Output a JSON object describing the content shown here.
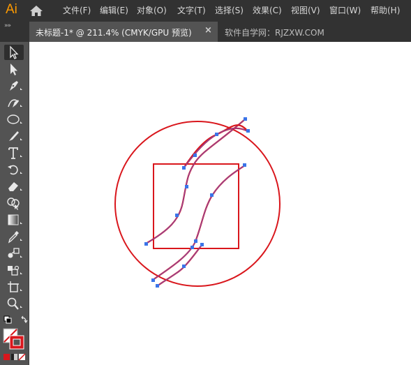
{
  "app": {
    "logo": "Ai"
  },
  "menu": {
    "items": [
      "文件(F)",
      "编辑(E)",
      "对象(O)",
      "文字(T)",
      "选择(S)",
      "效果(C)",
      "视图(V)",
      "窗口(W)",
      "帮助(H)"
    ]
  },
  "tabs": {
    "active": {
      "label": "未标题-1* @ 211.4% (CMYK/GPU 预览)",
      "close": "×"
    },
    "inactive": {
      "label": "软件自学网：RJZXW.COM"
    }
  },
  "toolbar": {
    "tools": [
      "selection-tool",
      "direct-selection-tool",
      "pen-tool",
      "curvature-tool",
      "ellipse-tool",
      "paintbrush-tool",
      "type-tool",
      "rotate-tool",
      "eraser-tool",
      "shape-builder-tool",
      "gradient-tool",
      "eyedropper-tool",
      "blend-tool",
      "live-paint-tool",
      "artboard-tool",
      "zoom-tool"
    ],
    "fill_color": "#ffffff",
    "stroke_color": "#d9161c"
  },
  "artwork": {
    "circle_stroke": "#d9161c",
    "square_stroke": "#d9161c",
    "path_color": "#8b3fa8",
    "anchor_color": "#3b74e8"
  }
}
